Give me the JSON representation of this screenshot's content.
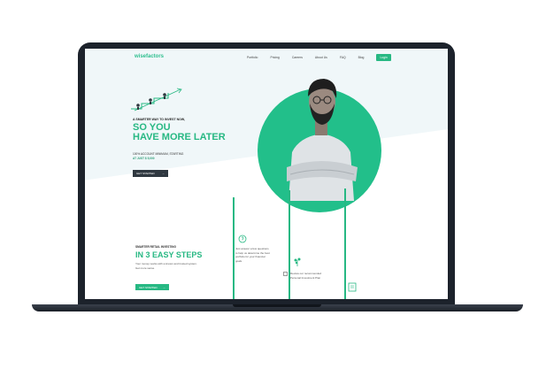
{
  "brand": {
    "logo": "wisefactors",
    "accent": "#27b883",
    "dark": "#2f3840"
  },
  "nav": {
    "items": [
      "Portfolio",
      "Pricing",
      "Careers",
      "About Us",
      "FAQ",
      "Blog"
    ],
    "login": "Login"
  },
  "hero": {
    "eyebrow": "A SMARTER WAY TO INVEST NOW,",
    "headline_line1": "SO YOU",
    "headline_line2": "HAVE MORE LATER",
    "subtext_line1": "100% ACCOUNT MINIMUM, STARTING",
    "subtext_line2": "AT JUST $ 5,000",
    "cta_label": "GET STARTED",
    "cta_arrow": "→"
  },
  "steps": {
    "eyebrow": "SMARTER RETAIL INVESTING",
    "title": "IN 3 EASY STEPS",
    "description": "Your money works with a known and trusted system. Get more sense",
    "cta_label": "GET STARTED",
    "cta_arrow": "→",
    "step1_text": "Just answer a few questions to help us determine the best portfolio for your financial goals",
    "step2_text": "Review our recommended Personal Investment Plan"
  }
}
